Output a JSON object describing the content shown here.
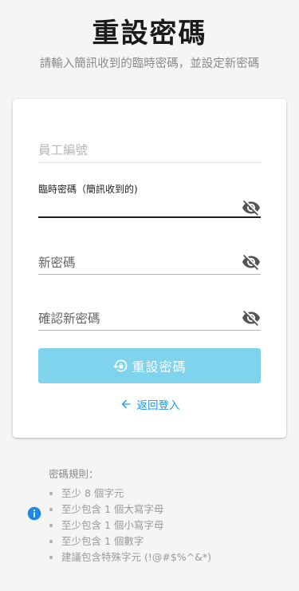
{
  "header": {
    "title": "重設密碼",
    "subtitle": "請輸入簡訊收到的臨時密碼，並設定新密碼"
  },
  "form": {
    "employee_id_placeholder": "員工編號",
    "temp_password_label": "臨時密碼（簡訊收到的)",
    "temp_password_value": "",
    "new_password_label": "新密碼",
    "confirm_password_label": "確認新密碼",
    "submit_label": "重設密碼",
    "back_label": "返回登入"
  },
  "rules": {
    "title": "密碼規則：",
    "items": [
      "至少 8 個字元",
      "至少包含 1 個大寫字母",
      "至少包含 1 個小寫字母",
      "至少包含 1 個數字",
      "建議包含特殊字元 (!@#$%^&*)"
    ]
  },
  "icons": {
    "password_toggle": "visibility-off-icon",
    "submit": "lock-reset-icon",
    "back": "arrow-left-icon",
    "info": "info-icon"
  },
  "colors": {
    "accent": "#2196f3",
    "button_disabled": "#7fd3ec",
    "info": "#1e88e5"
  }
}
